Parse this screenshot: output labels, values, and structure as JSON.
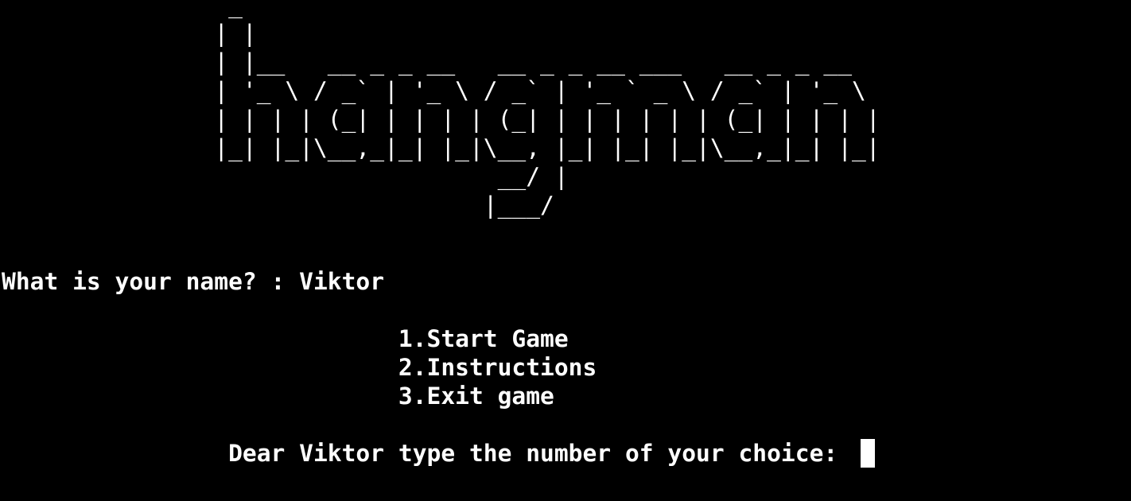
{
  "terminal": {
    "background": "#000000",
    "foreground": "#ffffff",
    "banner": [
      "                _",
      "               | |",
      "               | |__   __ _ _ __   __ _ _ __ ___   __ _ _ __",
      "               | '_ \\ / _` | '_ \\ / _` | '_ ` _ \\ / _` | '_ \\",
      "               | | | | (_| | | | | (_| | | | | | | (_| | | | |",
      "               |_| |_|\\__,_|_| |_|\\__, |_| |_| |_|\\__,_|_| |_|",
      "                                   __/ |",
      "                                  |___/"
    ],
    "name_prompt": "What is your name? : Viktor",
    "menu": [
      "                            1.Start Game",
      "                            2.Instructions",
      "                            3.Exit game"
    ],
    "choice_prompt": "                Dear Viktor type the number of your choice: "
  }
}
